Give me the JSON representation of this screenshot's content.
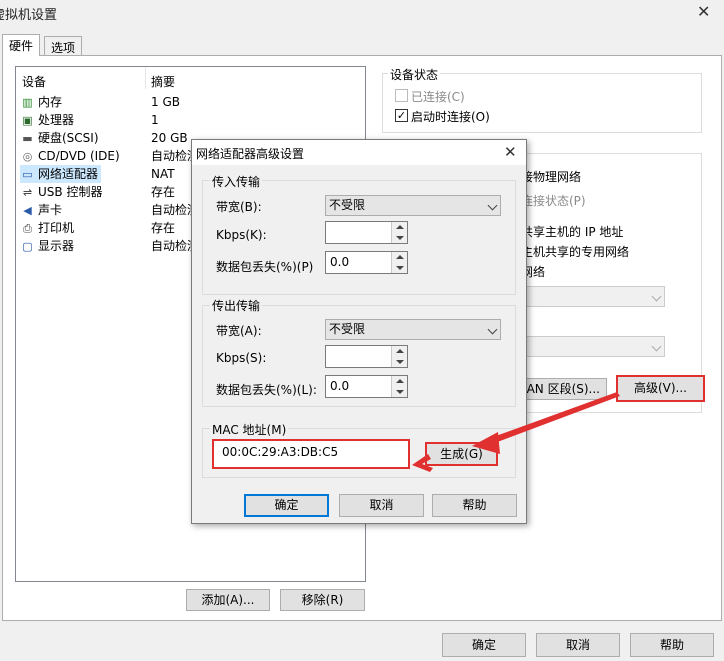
{
  "window": {
    "title": "虚拟机设置",
    "close_glyph": "✕"
  },
  "tabs": [
    {
      "label": "硬件"
    },
    {
      "label": "选项"
    }
  ],
  "hardware": {
    "col_device": "设备",
    "col_summary": "摘要",
    "rows": [
      {
        "icon": "memory-icon",
        "name": "内存",
        "summary": "1 GB"
      },
      {
        "icon": "cpu-icon",
        "name": "处理器",
        "summary": "1"
      },
      {
        "icon": "disk-icon",
        "name": "硬盘(SCSI)",
        "summary": "20 GB"
      },
      {
        "icon": "cd-icon",
        "name": "CD/DVD (IDE)",
        "summary": "自动检测"
      },
      {
        "icon": "network-adapter-icon",
        "name": "网络适配器",
        "summary": "NAT"
      },
      {
        "icon": "usb-icon",
        "name": "USB 控制器",
        "summary": "存在"
      },
      {
        "icon": "sound-icon",
        "name": "声卡",
        "summary": "自动检测"
      },
      {
        "icon": "printer-icon",
        "name": "打印机",
        "summary": "存在"
      },
      {
        "icon": "display-icon",
        "name": "显示器",
        "summary": "自动检测"
      }
    ],
    "add_button": "添加(A)...",
    "remove_button": "移除(R)"
  },
  "device_status": {
    "title": "设备状态",
    "connected": {
      "label": "已连接(C)",
      "checked": false
    },
    "connect_on_power": {
      "label": "启动时连接(O)",
      "checked": true
    }
  },
  "connection_partial": {
    "bridged_tail": "接物理网络",
    "replicate_tail": "连接状态(P)",
    "nat_tail": "共享主机的 IP 地址",
    "hostonly_tail": "主机共享的专用网络",
    "custom_tail": "网络",
    "lan_button_tail": "LAN 区段(S)...",
    "advanced_button": "高级(V)..."
  },
  "footer": {
    "ok": "确定",
    "cancel": "取消",
    "help": "帮助"
  },
  "dialog": {
    "title": "网络适配器高级设置",
    "close_glyph": "✕",
    "incoming": {
      "title": "传入传输",
      "bandwidth_label": "带宽(B):",
      "bandwidth_value": "不受限",
      "kbps_label": "Kbps(K):",
      "kbps_value": "",
      "loss_label": "数据包丢失(%)(P)",
      "loss_value": "0.0"
    },
    "outgoing": {
      "title": "传出传输",
      "bandwidth_label": "带宽(A):",
      "bandwidth_value": "不受限",
      "kbps_label": "Kbps(S):",
      "kbps_value": "",
      "loss_label": "数据包丢失(%)(L):",
      "loss_value": "0.0"
    },
    "mac": {
      "title": "MAC 地址(M)",
      "value": "00:0C:29:A3:DB:C5",
      "generate_button": "生成(G)"
    },
    "ok": "确定",
    "cancel": "取消",
    "help": "帮助"
  }
}
